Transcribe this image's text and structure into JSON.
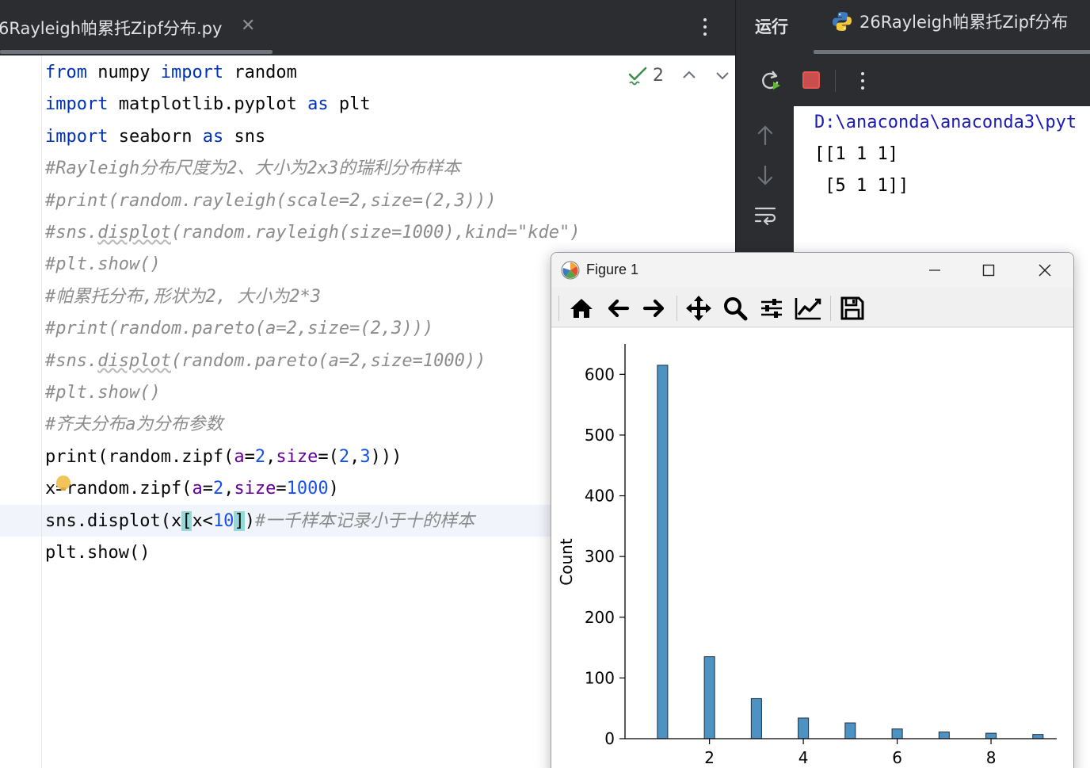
{
  "editor": {
    "tab_title": "6Rayleigh帕累托Zipf分布.py",
    "tab_close_glyph": "✕",
    "inspection_count": "2",
    "lines": [
      [
        {
          "t": "from",
          "c": "kw"
        },
        {
          "t": " numpy "
        },
        {
          "t": "import",
          "c": "kw"
        },
        {
          "t": " random"
        }
      ],
      [
        {
          "t": "import",
          "c": "kw"
        },
        {
          "t": " matplotlib.pyplot "
        },
        {
          "t": "as",
          "c": "kw"
        },
        {
          "t": " plt"
        }
      ],
      [
        {
          "t": "import",
          "c": "kw"
        },
        {
          "t": " seaborn "
        },
        {
          "t": "as",
          "c": "kw"
        },
        {
          "t": " sns"
        }
      ],
      [
        {
          "t": "#Rayleigh分布尺度为2、大小为2x3的瑞利分布样本",
          "c": "cm"
        }
      ],
      [
        {
          "t": "#print(random.rayleigh(scale=2,size=(2,3)))",
          "c": "cm"
        }
      ],
      [
        {
          "t": "#sns.",
          "c": "cm"
        },
        {
          "t": "displot",
          "c": "cm warn-under"
        },
        {
          "t": "(random.rayleigh(size=1000),kind=\"kde\")",
          "c": "cm"
        }
      ],
      [
        {
          "t": "#plt.show()",
          "c": "cm"
        }
      ],
      [
        {
          "t": "#帕累托分布,形状为2, 大小为2*3",
          "c": "cm"
        }
      ],
      [
        {
          "t": "#print(random.pareto(a=2,size=(2,3)))",
          "c": "cm"
        }
      ],
      [
        {
          "t": "#sns.",
          "c": "cm"
        },
        {
          "t": "displot",
          "c": "cm warn-under"
        },
        {
          "t": "(random.pareto(a=2,size=1000))",
          "c": "cm"
        }
      ],
      [
        {
          "t": "#plt.show()",
          "c": "cm"
        }
      ],
      [
        {
          "t": "#齐夫分布a为分布参数",
          "c": "cm"
        }
      ],
      [
        {
          "t": "print"
        },
        {
          "t": "(random.zipf("
        },
        {
          "t": "a",
          "c": "kwarg"
        },
        {
          "t": "="
        },
        {
          "t": "2",
          "c": "num"
        },
        {
          "t": ","
        },
        {
          "t": "size",
          "c": "kwarg"
        },
        {
          "t": "=("
        },
        {
          "t": "2",
          "c": "num"
        },
        {
          "t": ","
        },
        {
          "t": "3",
          "c": "num"
        },
        {
          "t": ")))"
        }
      ],
      [
        {
          "t": "x=random.zipf("
        },
        {
          "t": "a",
          "c": "kwarg"
        },
        {
          "t": "="
        },
        {
          "t": "2",
          "c": "num"
        },
        {
          "t": ","
        },
        {
          "t": "size",
          "c": "kwarg"
        },
        {
          "t": "="
        },
        {
          "t": "1000",
          "c": "num"
        },
        {
          "t": ")"
        }
      ],
      [
        {
          "t": "sns.displot(x"
        },
        {
          "t": "[",
          "c": "paren-hl"
        },
        {
          "t": "x<"
        },
        {
          "t": "10",
          "c": "num"
        },
        {
          "t": "]",
          "c": "paren-hl"
        },
        {
          "t": ")"
        },
        {
          "t": "#一千样本记录小于十的样本",
          "c": "cm"
        }
      ],
      [
        {
          "t": "plt.show()"
        }
      ]
    ]
  },
  "run_panel": {
    "label": "运行",
    "tab_title": "26Rayleigh帕累托Zipf分布",
    "console_lines": [
      "D:\\anaconda\\anaconda3\\pyt",
      "[[1 1 1]",
      " [5 1 1]]"
    ]
  },
  "figure": {
    "title": "Figure 1",
    "toolbar": [
      "home-icon",
      "back-icon",
      "forward-icon",
      "pan-icon",
      "zoom-icon",
      "configure-subplots-icon",
      "edit-axis-icon",
      "save-icon"
    ]
  },
  "colors": {
    "bar_fill": "#4c92c3",
    "bar_edge": "#1f2f3f",
    "keyword": "#0033b3",
    "comment": "#8c8c8c",
    "number": "#1750eb",
    "kwarg": "#660099"
  },
  "chart_data": {
    "type": "bar",
    "x": [
      1,
      2,
      3,
      4,
      5,
      6,
      7,
      8,
      9
    ],
    "values": [
      615,
      135,
      66,
      34,
      26,
      16,
      11,
      9,
      7
    ],
    "xlim": [
      0.2,
      9.4
    ],
    "ylim": [
      0,
      650
    ],
    "xticks": [
      2,
      4,
      6,
      8
    ],
    "yticks": [
      0,
      100,
      200,
      300,
      400,
      500,
      600
    ],
    "ylabel": "Count",
    "xlabel": "",
    "grid": false,
    "legend": "none"
  }
}
